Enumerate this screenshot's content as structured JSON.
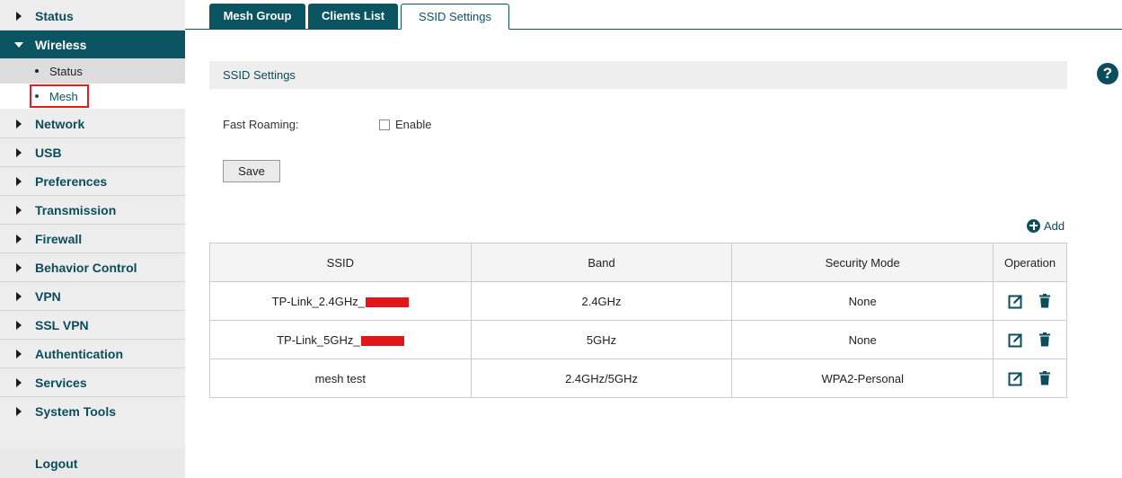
{
  "sidebar": {
    "items": [
      {
        "label": "Status"
      },
      {
        "label": "Wireless"
      },
      {
        "label": "Network"
      },
      {
        "label": "USB"
      },
      {
        "label": "Preferences"
      },
      {
        "label": "Transmission"
      },
      {
        "label": "Firewall"
      },
      {
        "label": "Behavior Control"
      },
      {
        "label": "VPN"
      },
      {
        "label": "SSL VPN"
      },
      {
        "label": "Authentication"
      },
      {
        "label": "Services"
      },
      {
        "label": "System Tools"
      }
    ],
    "wireless_sub": [
      {
        "label": "Status"
      },
      {
        "label": "Mesh"
      }
    ],
    "logout_label": "Logout"
  },
  "tabs": [
    {
      "label": "Mesh Group"
    },
    {
      "label": "Clients List"
    },
    {
      "label": "SSID Settings"
    }
  ],
  "section": {
    "title": "SSID Settings"
  },
  "help_icon": "?",
  "fast_roaming": {
    "label": "Fast Roaming:",
    "checkbox_label": "Enable",
    "checked": false
  },
  "save_label": "Save",
  "add_label": "Add",
  "table": {
    "headers": [
      "SSID",
      "Band",
      "Security Mode",
      "Operation"
    ],
    "rows": [
      {
        "ssid": "TP-Link_2.4GHz_",
        "redacted": true,
        "band": "2.4GHz",
        "security": "None"
      },
      {
        "ssid": "TP-Link_5GHz_",
        "redacted": true,
        "band": "5GHz",
        "security": "None"
      },
      {
        "ssid": "mesh test",
        "redacted": false,
        "band": "2.4GHz/5GHz",
        "security": "WPA2-Personal"
      }
    ]
  },
  "colors": {
    "accent": "#0b5563",
    "highlight": "#e02020",
    "redaction": "#e0161b"
  }
}
